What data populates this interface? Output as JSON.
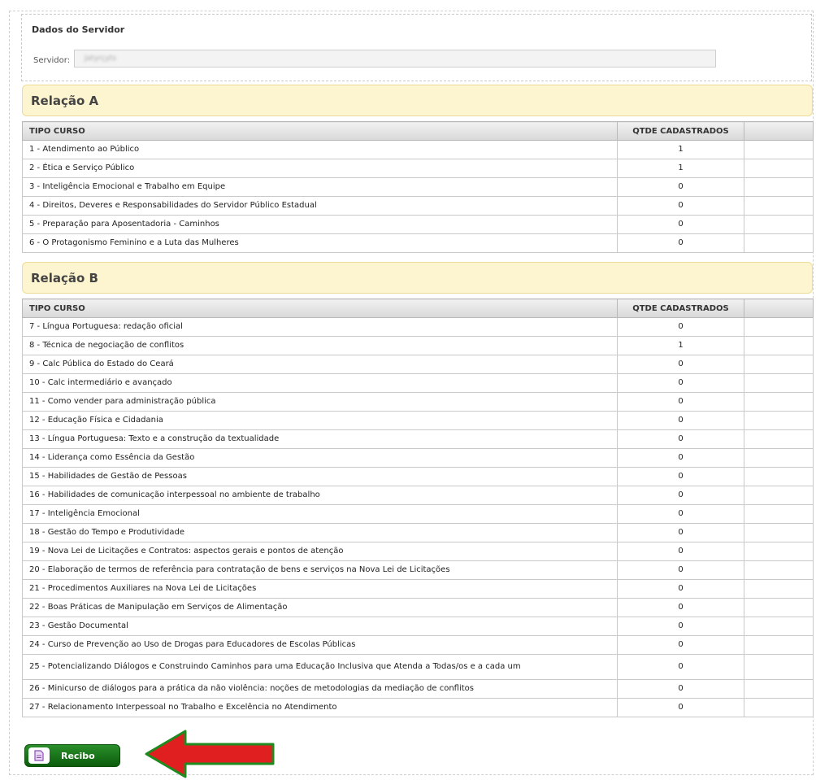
{
  "servidor": {
    "title": "Dados do Servidor",
    "label": "Servidor:",
    "value": "Jatyrçyts"
  },
  "relacao_a": {
    "title": "Relação A",
    "col_tipo": "TIPO CURSO",
    "col_qtde": "QTDE CADASTRADOS",
    "rows": [
      {
        "curso": "1 - Atendimento ao Público",
        "qtde": "1"
      },
      {
        "curso": "2 - Ética e Serviço Público",
        "qtde": "1"
      },
      {
        "curso": "3 - Inteligência Emocional e Trabalho em Equipe",
        "qtde": "0"
      },
      {
        "curso": "4 - Direitos, Deveres e Responsabilidades do Servidor Público Estadual",
        "qtde": "0"
      },
      {
        "curso": "5 - Preparação para Aposentadoria - Caminhos",
        "qtde": "0"
      },
      {
        "curso": "6 - O Protagonismo Feminino e a Luta das Mulheres",
        "qtde": "0"
      }
    ]
  },
  "relacao_b": {
    "title": "Relação B",
    "col_tipo": "TIPO CURSO",
    "col_qtde": "QTDE CADASTRADOS",
    "rows": [
      {
        "curso": "7 - Língua Portuguesa: redação oficial",
        "qtde": "0"
      },
      {
        "curso": "8 - Técnica de negociação de conflitos",
        "qtde": "1"
      },
      {
        "curso": "9 - Calc Pública do Estado do Ceará",
        "qtde": "0"
      },
      {
        "curso": "10 - Calc intermediário e avançado",
        "qtde": "0"
      },
      {
        "curso": "11 - Como vender para administração pública",
        "qtde": "0"
      },
      {
        "curso": "12 - Educação Física e Cidadania",
        "qtde": "0"
      },
      {
        "curso": "13 - Língua Portuguesa: Texto e a construção da textualidade",
        "qtde": "0"
      },
      {
        "curso": "14 - Liderança como Essência da Gestão",
        "qtde": "0"
      },
      {
        "curso": "15 - Habilidades de Gestão de Pessoas",
        "qtde": "0"
      },
      {
        "curso": "16 - Habilidades de comunicação interpessoal no ambiente de trabalho",
        "qtde": "0"
      },
      {
        "curso": "17 - Inteligência Emocional",
        "qtde": "0"
      },
      {
        "curso": "18 - Gestão do Tempo e Produtividade",
        "qtde": "0"
      },
      {
        "curso": "19 - Nova Lei de Licitações e Contratos: aspectos gerais e pontos de atenção",
        "qtde": "0"
      },
      {
        "curso": "20 - Elaboração de termos de referência para contratação de bens e serviços na Nova Lei de Licitações",
        "qtde": "0"
      },
      {
        "curso": "21 - Procedimentos Auxiliares na Nova Lei de Licitações",
        "qtde": "0"
      },
      {
        "curso": "22 - Boas Práticas de Manipulação em Serviços de Alimentação",
        "qtde": "0"
      },
      {
        "curso": "23 - Gestão Documental",
        "qtde": "0"
      },
      {
        "curso": "24 - Curso de Prevenção ao Uso de Drogas para Educadores de Escolas Públicas",
        "qtde": "0"
      },
      {
        "curso": "25 - Potencializando Diálogos e Construindo Caminhos para uma Educação Inclusiva que Atenda a Todas/os e a cada um",
        "qtde": "0"
      },
      {
        "curso": "26 - Minicurso de diálogos para a prática da não violência: noções de metodologias da mediação de conflitos",
        "qtde": "0"
      },
      {
        "curso": "27 - Relacionamento Interpessoal no Trabalho e Excelência no Atendimento",
        "qtde": "0"
      }
    ]
  },
  "recibo_button": {
    "label": "Recibo",
    "icon": "document-icon"
  },
  "colors": {
    "section_bg": "#fdf5cf",
    "button_green": "#1a7a1a",
    "arrow_red": "#e02020",
    "arrow_outline": "#1f8a1f"
  }
}
